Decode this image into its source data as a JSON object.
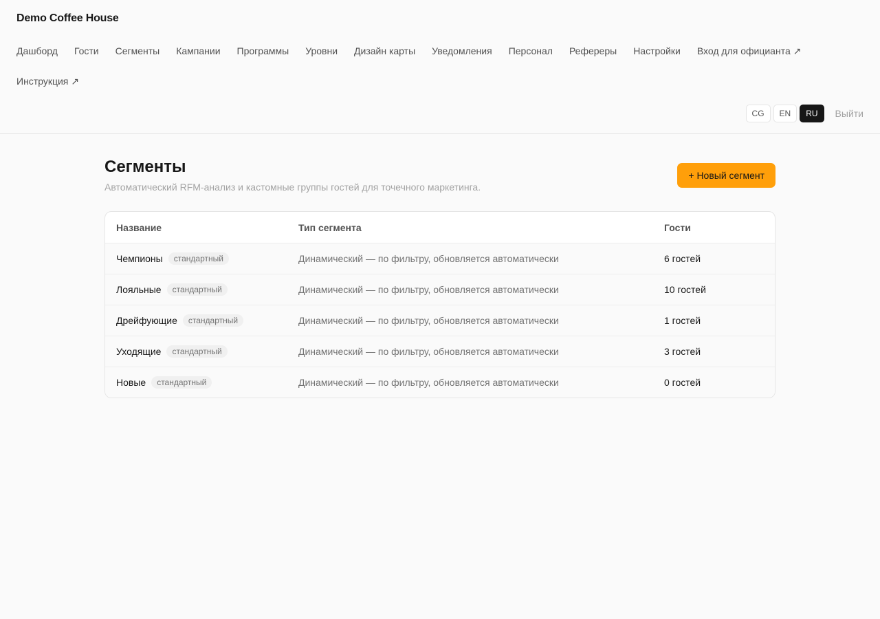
{
  "app": {
    "brand": "Demo Coffee House"
  },
  "nav": {
    "items": [
      "Дашборд",
      "Гости",
      "Сегменты",
      "Кампании",
      "Программы",
      "Уровни",
      "Дизайн карты",
      "Уведомления",
      "Персонал",
      "Рефереры",
      "Настройки",
      "Вход для официанта ↗",
      "Инструкция ↗"
    ]
  },
  "languages": {
    "options": [
      "CG",
      "EN",
      "RU"
    ],
    "selected": "RU"
  },
  "logout_label": "Выйти",
  "page": {
    "title": "Сегменты",
    "subtitle": "Автоматический RFM-анализ и кастомные группы гостей для точечного маркетинга.",
    "new_button": "+ Новый сегмент"
  },
  "table": {
    "headers": {
      "name": "Название",
      "type": "Тип сегмента",
      "guests": "Гости"
    },
    "rows": [
      {
        "name": "Чемпионы",
        "badge": "стандартный",
        "type": "Динамический — по фильтру, обновляется автоматически",
        "guests": "6 гостей"
      },
      {
        "name": "Лояльные",
        "badge": "стандартный",
        "type": "Динамический — по фильтру, обновляется автоматически",
        "guests": "10 гостей"
      },
      {
        "name": "Дрейфующие",
        "badge": "стандартный",
        "type": "Динамический — по фильтру, обновляется автоматически",
        "guests": "1 гостей"
      },
      {
        "name": "Уходящие",
        "badge": "стандартный",
        "type": "Динамический — по фильтру, обновляется автоматически",
        "guests": "3 гостей"
      },
      {
        "name": "Новые",
        "badge": "стандартный",
        "type": "Динамический — по фильтру, обновляется автоматически",
        "guests": "0 гостей"
      }
    ]
  },
  "colors": {
    "accent": "#ff9f0a",
    "active_lang": "#171717",
    "background": "#fafafa"
  }
}
